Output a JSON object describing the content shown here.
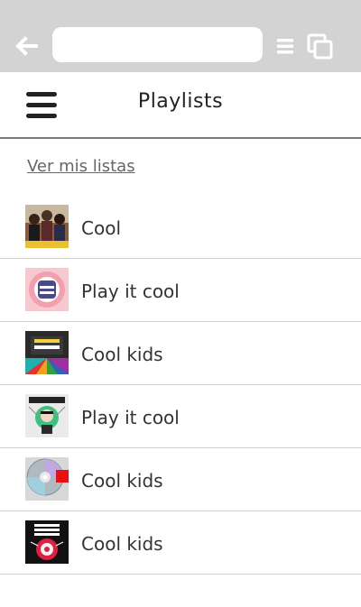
{
  "browser": {
    "url_value": "",
    "icons": {
      "back": "back-arrow-icon",
      "menu": "menu-lines-icon",
      "tabs": "tabs-icon"
    }
  },
  "header": {
    "title": "Playlists",
    "menu_icon": "hamburger-icon"
  },
  "my_lists_link": "Ver mis listas",
  "playlists": [
    {
      "title": "Cool",
      "cover": "album-cover-group-photo"
    },
    {
      "title": "Play it cool",
      "cover": "album-cover-pink-emblem"
    },
    {
      "title": "Cool kids",
      "cover": "album-cover-colorful-rays"
    },
    {
      "title": "Play it cool",
      "cover": "album-cover-duck-sauce"
    },
    {
      "title": "Cool kids",
      "cover": "album-cover-cd-disc"
    },
    {
      "title": "Cool kids",
      "cover": "album-cover-power-glory"
    }
  ],
  "colors": {
    "browser_bar": "#d3d3d3",
    "header_border": "#7a7a7a",
    "link": "#666666",
    "text": "#333333"
  }
}
